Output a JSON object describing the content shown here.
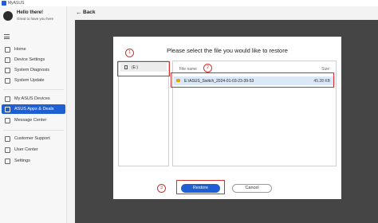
{
  "window": {
    "title": "MyASUS"
  },
  "profile": {
    "greeting": "Hello there!",
    "subtitle": "Great to have you here"
  },
  "nav": {
    "items": [
      {
        "label": "Home",
        "icon": "home-icon"
      },
      {
        "label": "Device Settings",
        "icon": "device-settings-icon"
      },
      {
        "label": "System Diagnosis",
        "icon": "diagnosis-icon"
      },
      {
        "label": "System Update",
        "icon": "update-icon"
      },
      {
        "label": "My ASUS Devices",
        "icon": "devices-icon"
      },
      {
        "label": "ASUS Apps & Deals",
        "icon": "apps-icon",
        "active": true
      },
      {
        "label": "Message Center",
        "icon": "message-icon"
      },
      {
        "label": "Customer Support",
        "icon": "support-icon"
      },
      {
        "label": "User Center",
        "icon": "user-icon"
      },
      {
        "label": "Settings",
        "icon": "settings-icon"
      }
    ]
  },
  "header": {
    "back_label": "Back",
    "back_glyph": "←"
  },
  "dialog": {
    "title": "Please select the file you would like to restore",
    "drive_label": "(E:)",
    "columns": {
      "name": "File name",
      "size": "Size"
    },
    "file": {
      "name": "E:\\ASUS_Switch_2024-01-03-23-39-53",
      "size": "45.28 KB"
    },
    "restore_label": "Restore",
    "cancel_label": "Cancel"
  },
  "annotations": {
    "step1": "1",
    "step2": "2",
    "step3": "3"
  },
  "colors": {
    "accent": "#1e5fd4",
    "highlight": "#d0312d",
    "overlay": "#454545"
  }
}
